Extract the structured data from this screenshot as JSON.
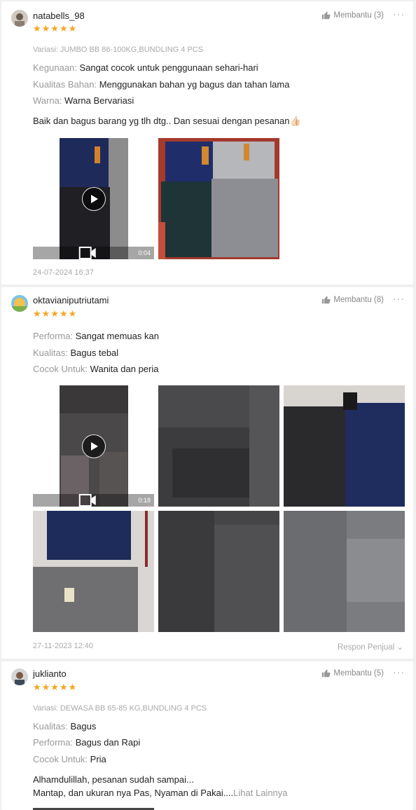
{
  "reviews": [
    {
      "username": "natabells_98",
      "stars": "★★★★★",
      "helpful_label": "Membantu (3)",
      "more_label": "···",
      "variant": "Variasi: JUMBO BB 86-100KG,BUNDLING 4 PCS",
      "attributes": [
        {
          "key": "Kegunaan:",
          "value": "Sangat cocok untuk penggunaan sehari-hari"
        },
        {
          "key": "Kualitas Bahan:",
          "value": "Menggunakan bahan yg bagus dan tahan lama"
        },
        {
          "key": "Warna:",
          "value": "Warna Bervariasi"
        }
      ],
      "comment": "Baik dan bagus barang yg tlh dtg.. Dan sesuai dengan pesanan👍🏻",
      "video_duration": "0:04",
      "date": "24-07-2024 16:37"
    },
    {
      "username": "oktavianiputriutami",
      "stars": "★★★★★",
      "helpful_label": "Membantu (8)",
      "more_label": "···",
      "attributes": [
        {
          "key": "Performa:",
          "value": "Sangat memuas kan"
        },
        {
          "key": "Kualitas:",
          "value": "Bagus tebal"
        },
        {
          "key": "Cocok Untuk:",
          "value": "Wanita dan peria"
        }
      ],
      "video_duration": "0:18",
      "date": "27-11-2023 12:40",
      "reply_label": "Respon Penjual ⌄"
    },
    {
      "username": "juklianto",
      "stars": "★★★★★",
      "helpful_label": "Membantu (5)",
      "more_label": "···",
      "variant": "Variasi: DEWASA BB 65-85 KG,BUNDLING 4 PCS",
      "attributes": [
        {
          "key": "Kualitas:",
          "value": "Bagus"
        },
        {
          "key": "Performa:",
          "value": "Bagus dan Rapi"
        },
        {
          "key": "Cocok Untuk:",
          "value": "Pria"
        }
      ],
      "comment_line1": "Alhamdulillah, pesanan sudah sampai...",
      "comment_line2": "Mantap, dan ukuran nya Pas, Nyaman di Pakai....",
      "see_more": "Lihat Lainnya"
    }
  ],
  "colors": {
    "star": "#f5a623",
    "muted": "#999999",
    "text": "#222222"
  },
  "icons": {
    "helpful": "thumbs-up-icon",
    "video": "video-camera-icon",
    "play": "play-icon"
  }
}
